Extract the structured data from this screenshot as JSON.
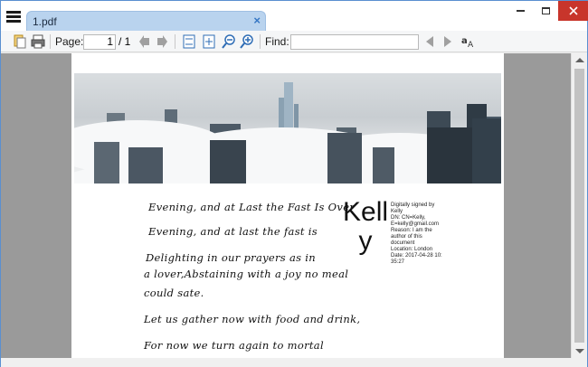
{
  "window": {
    "tab_title": "1.pdf",
    "tab_close_symbol": "×"
  },
  "toolbar": {
    "page_label": "Page:",
    "page_current": "1",
    "page_total": "/ 1",
    "find_label": "Find:",
    "find_value": "",
    "icons": [
      "open-file-icon",
      "print-icon",
      "previous-page-icon",
      "next-page-icon",
      "fit-page-icon",
      "fit-width-icon",
      "zoom-out-icon",
      "zoom-in-icon",
      "find-previous-icon",
      "find-next-icon",
      "match-case-icon"
    ]
  },
  "document": {
    "poem": [
      "Evening, and at Last the Fast Is Over",
      "Evening, and at last the fast is",
      "Delighting in our prayers as in",
      "a lover,Abstaining with a joy no meal",
      "could sate.",
      "Let us gather now with food and drink,",
      "For now we turn again to mortal"
    ],
    "signature": {
      "name_line1": "Kell",
      "name_line2": "y",
      "details": [
        "Digitally signed by",
        "Kelly",
        "DN: CN=Kelly,",
        "E=kelly@gmail.com",
        "Reason: I am the",
        "author of this",
        "document",
        "Location: London",
        "Date: 2017-04-28 10:",
        "35:27"
      ]
    }
  },
  "colors": {
    "tab_bg": "#b9d3ee",
    "close_button": "#c8352b",
    "viewer_bg": "#9a9a9a"
  }
}
